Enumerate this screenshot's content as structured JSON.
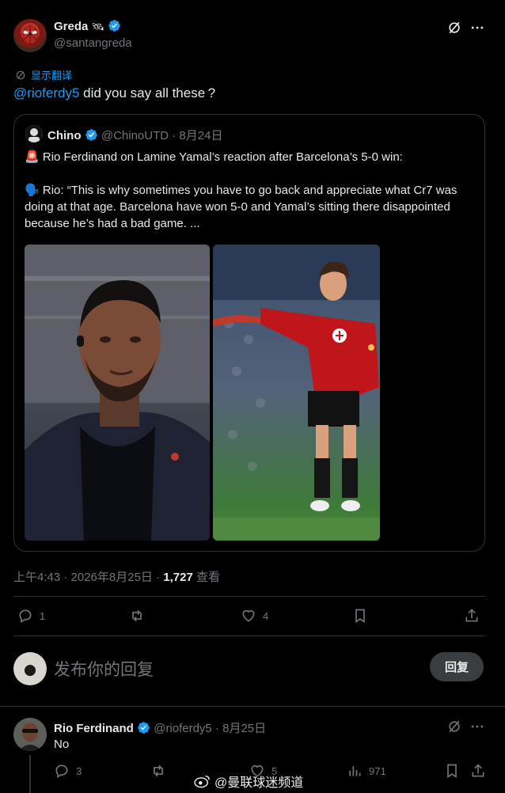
{
  "post": {
    "author_name": "Greda",
    "author_emoji": "🛰",
    "author_handle": "@santangreda",
    "translate_label": "显示翻译",
    "mention": "@rioferdy5",
    "text": " did you say all these ?",
    "timestamp": "上午4:43 · 2026年8月25日 · ",
    "views_count": "1,727",
    "views_label": " 查看",
    "counts": {
      "replies": "1",
      "reposts": "",
      "likes": "4"
    }
  },
  "quote": {
    "author_name": "Chino",
    "author_handle": "@ChinoUTD",
    "date": " · 8月24日",
    "line1_emoji": "🚨",
    "line1": " Rio Ferdinand on Lamine Yamal’s reaction after Barcelona’s 5-0 win:",
    "line2_emoji": "🗣️",
    "line2": " Rio: “This is why sometimes you have to go back and appreciate what Cr7 was doing at that age. Barcelona have won 5-0 and Yamal’s sitting there disappointed because he’s had a bad game. ...",
    "image1_alt": "Rio Ferdinand photo",
    "image2_alt": "Young Cristiano Ronaldo in Manchester United kit"
  },
  "compose": {
    "placeholder": "发布你的回复",
    "reply_button": "回复"
  },
  "reply": {
    "author_name": "Rio Ferdinand",
    "author_handle": "@rioferdy5",
    "date": " · 8月25日",
    "text": "No",
    "counts": {
      "replies": "3",
      "reposts": "",
      "likes": "5",
      "views": "971"
    }
  },
  "watermark": "@曼联球迷频道",
  "colors": {
    "accent": "#1d9bf0",
    "muted": "#71767b",
    "background": "#000000",
    "border": "#2f3336"
  }
}
